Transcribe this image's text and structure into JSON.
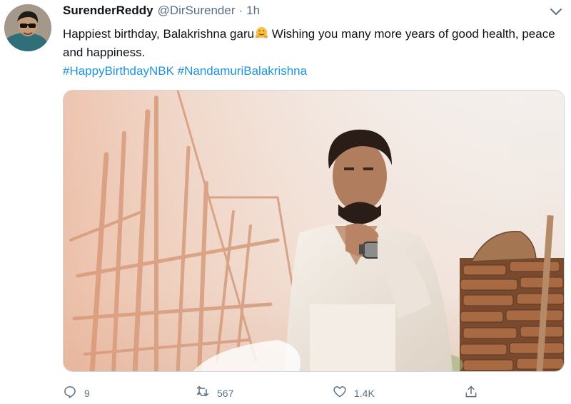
{
  "tweet": {
    "display_name": "SurenderReddy",
    "handle": "@DirSurender",
    "separator": "·",
    "time": "1h",
    "text": "Happiest birthday, Balakrishna garu",
    "text_emoji": "hugging-face-emoji",
    "text_after": " Wishing you many more years of good health, peace and happiness.",
    "hashtags": [
      "#HappyBirthdayNBK",
      "#NandamuriBalakrishna"
    ]
  },
  "actions": {
    "reply_count": "9",
    "retweet_count": "567",
    "like_count": "1.4K"
  },
  "icons": {
    "caret": "chevron-down-icon",
    "reply": "reply-icon",
    "retweet": "retweet-icon",
    "like": "heart-icon",
    "share": "share-icon"
  },
  "colors": {
    "text": "#0f1419",
    "secondary": "#5b7083",
    "link": "#1b95e0",
    "border": "#ccd6dd"
  }
}
